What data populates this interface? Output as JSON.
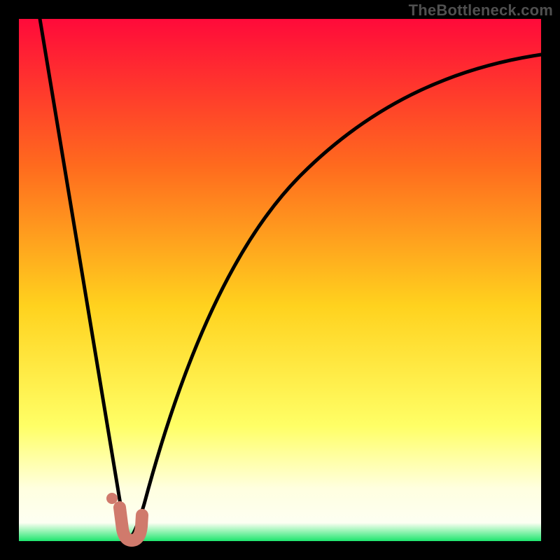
{
  "watermark": "TheBottleneck.com",
  "palette": {
    "black": "#000000",
    "frame_border": "#000000",
    "curve_stroke": "#000000",
    "marker_fill": "#d07a6c",
    "marker_stroke": "#c46a5e",
    "gradient_top": "#ff0a3a",
    "gradient_mid_upper": "#ff7a1e",
    "gradient_mid": "#ffd21e",
    "gradient_mid_lower": "#ffff66",
    "gradient_pale": "#ffffe0",
    "gradient_bottom": "#1ee66e"
  },
  "chart_data": {
    "type": "line",
    "title": "",
    "xlabel": "",
    "ylabel": "",
    "x_range": [
      0,
      100
    ],
    "y_range": [
      0,
      100
    ],
    "series": [
      {
        "name": "bottleneck-curve",
        "x": [
          0,
          4,
          8,
          12,
          14,
          15.5,
          17,
          18,
          19,
          21,
          24,
          28,
          34,
          42,
          52,
          64,
          78,
          92,
          100
        ],
        "y": [
          100,
          80,
          60,
          40,
          24,
          10,
          2,
          0,
          2,
          8,
          22,
          40,
          58,
          72,
          82,
          88,
          92,
          94,
          94.5
        ]
      }
    ],
    "markers": [
      {
        "name": "optimum-marker",
        "shape": "J",
        "x_range": [
          15.5,
          19.5
        ],
        "y_range": [
          0,
          6
        ]
      },
      {
        "name": "optimum-dot",
        "shape": "dot",
        "x": 15,
        "y": 7
      }
    ],
    "background_gradient": {
      "stops": [
        {
          "offset": 0.0,
          "color": "#ff0a3a"
        },
        {
          "offset": 0.28,
          "color": "#ff6a1e"
        },
        {
          "offset": 0.55,
          "color": "#ffd21e"
        },
        {
          "offset": 0.78,
          "color": "#ffff66"
        },
        {
          "offset": 0.9,
          "color": "#ffffe0"
        },
        {
          "offset": 0.965,
          "color": "#fdfff2"
        },
        {
          "offset": 1.0,
          "color": "#1ee66e"
        }
      ]
    }
  }
}
